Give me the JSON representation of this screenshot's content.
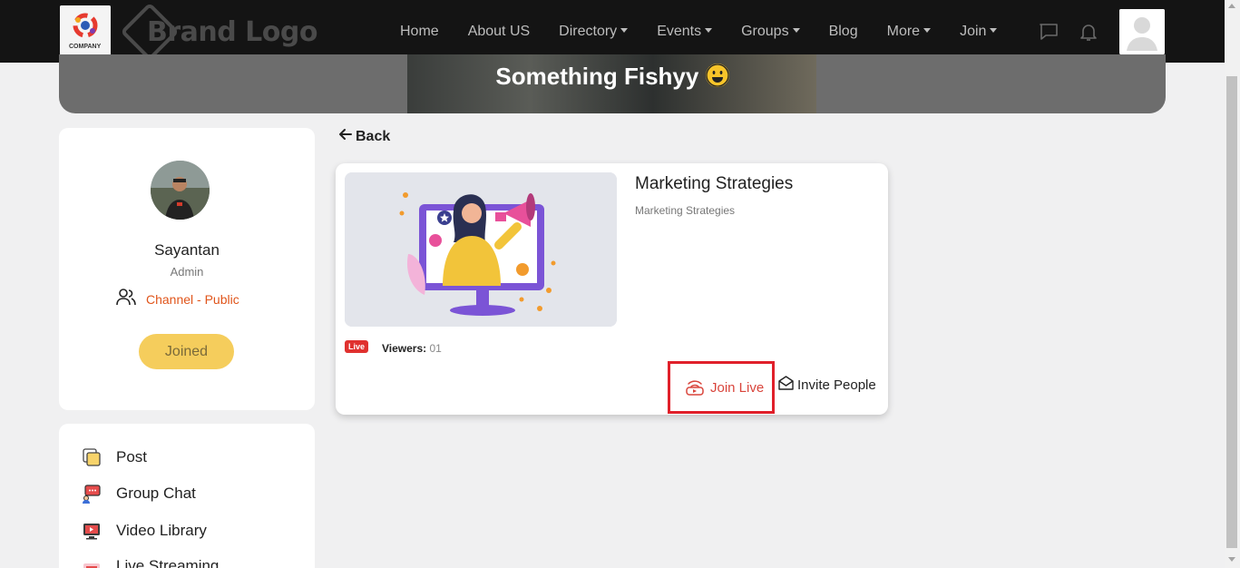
{
  "navbar": {
    "company_logo_text": "COMPANY",
    "brand_text": "Brand Logo",
    "links": [
      {
        "label": "Home",
        "dropdown": false
      },
      {
        "label": "About US",
        "dropdown": false
      },
      {
        "label": "Directory",
        "dropdown": true
      },
      {
        "label": "Events",
        "dropdown": true
      },
      {
        "label": "Groups",
        "dropdown": true
      },
      {
        "label": "Blog",
        "dropdown": false
      },
      {
        "label": "More",
        "dropdown": true
      },
      {
        "label": "Join",
        "dropdown": true
      }
    ],
    "icons": [
      "chat-icon",
      "bell-icon",
      "user-avatar-icon"
    ]
  },
  "banner": {
    "title": "Something Fishyy"
  },
  "profile": {
    "name": "Sayantan",
    "role": "Admin",
    "channel": "Channel - Public",
    "joined_label": "Joined"
  },
  "menu": {
    "items": [
      {
        "label": "Post",
        "icon": "post-icon"
      },
      {
        "label": "Group Chat",
        "icon": "group-chat-icon"
      },
      {
        "label": "Video Library",
        "icon": "video-library-icon"
      },
      {
        "label": "Live Streaming",
        "icon": "live-streaming-icon"
      }
    ]
  },
  "back_label": "Back",
  "stream": {
    "title": "Marketing Strategies",
    "subtitle": "Marketing Strategies",
    "live_badge": "Live",
    "viewers_label": "Viewers:",
    "viewers_count": "01",
    "join_live_label": "Join Live",
    "invite_label": "Invite People"
  },
  "colors": {
    "accent_orange": "#e0551b",
    "joined_yellow": "#f5cd5c",
    "live_red": "#e0312f",
    "navbar_bg": "#141414"
  }
}
